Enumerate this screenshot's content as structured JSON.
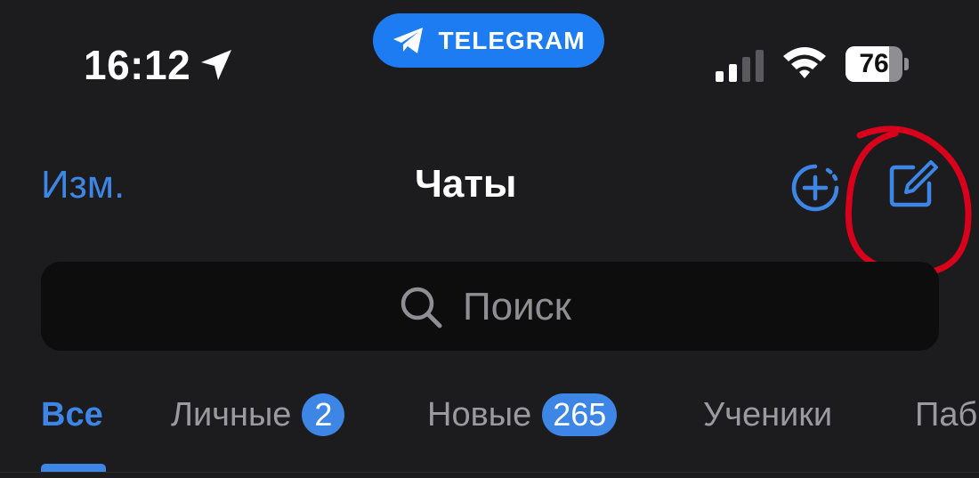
{
  "status_bar": {
    "time": "16:12",
    "location_icon": "location-arrow-icon",
    "app_pill": {
      "icon": "telegram-plane-icon",
      "label": "TELEGRAM"
    },
    "signal_icon": "cellular-signal-icon",
    "wifi_icon": "wifi-icon",
    "battery": {
      "label": "76",
      "level": 0.76
    }
  },
  "nav": {
    "edit_label": "Изм.",
    "title": "Чаты",
    "story_icon": "new-story-plus-icon",
    "compose_icon": "compose-edit-icon"
  },
  "search": {
    "placeholder": "Поиск",
    "icon": "search-icon"
  },
  "tabs": [
    {
      "label": "Все",
      "active": true
    },
    {
      "label": "Личные",
      "badge": "2"
    },
    {
      "label": "Новые",
      "badge": "265"
    },
    {
      "label": "Ученики"
    },
    {
      "label": "Паб"
    }
  ],
  "colors": {
    "background": "#1c1c1e",
    "accent": "#3d86e6",
    "telegram_pill": "#1e7cf2",
    "annotation": "#d9001b"
  }
}
